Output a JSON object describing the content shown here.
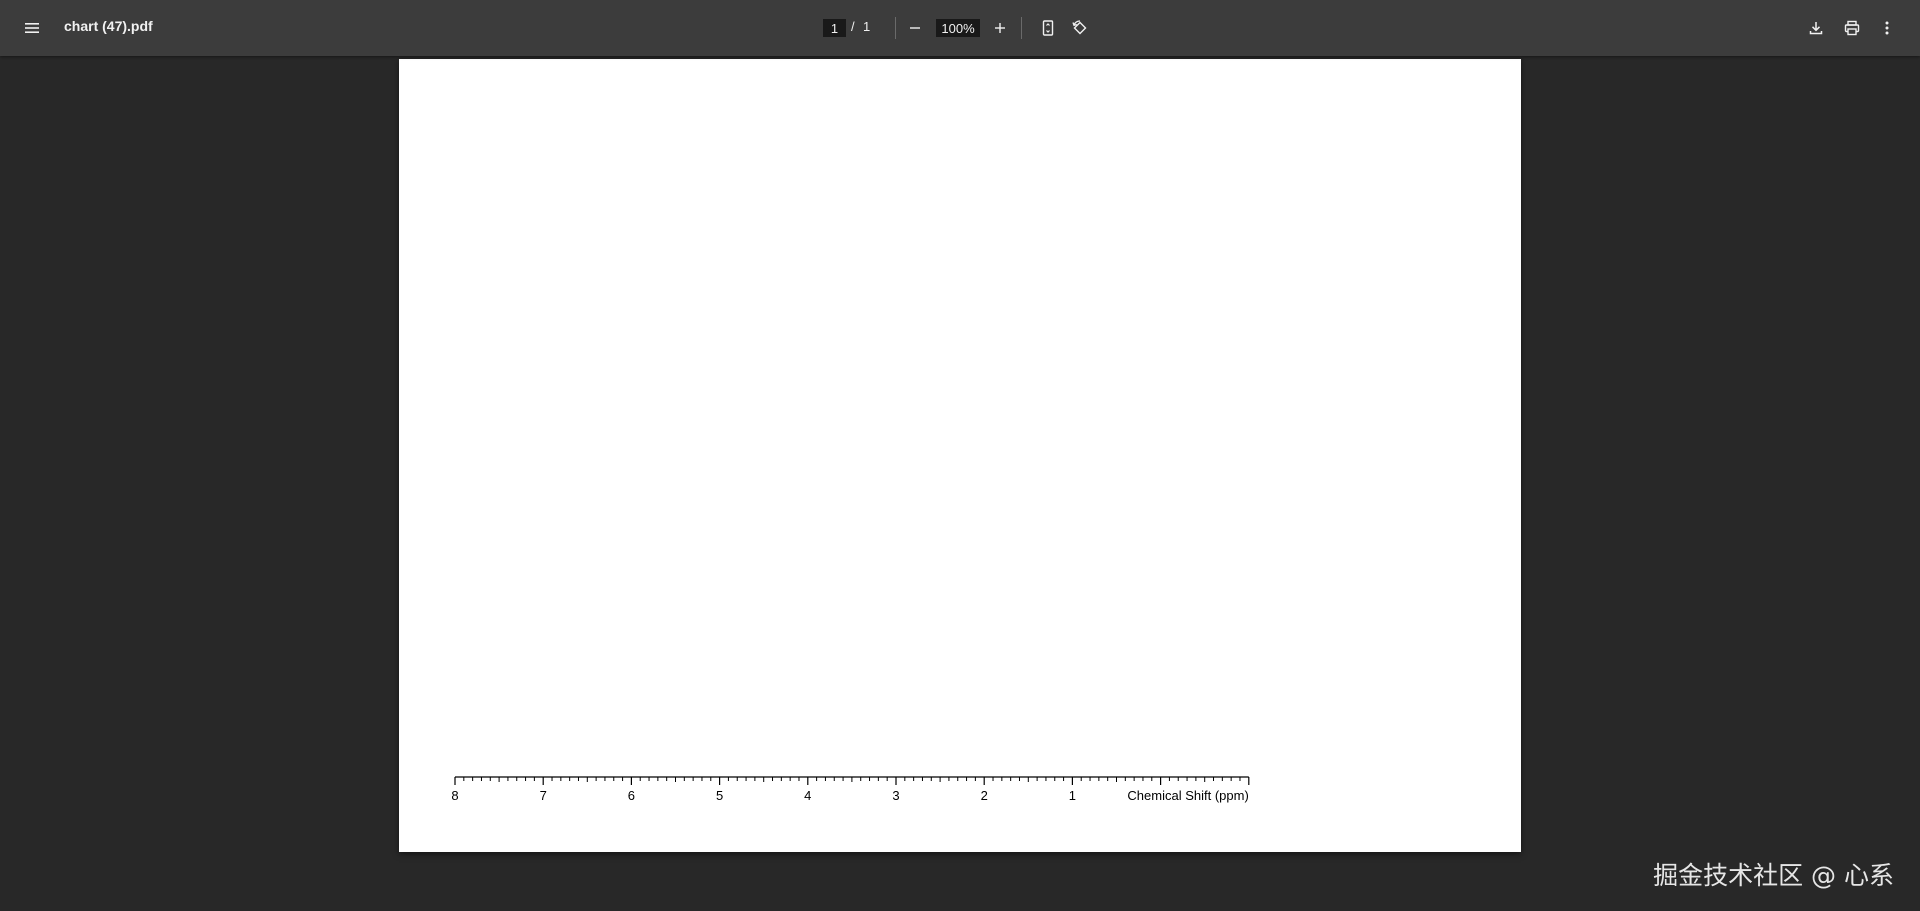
{
  "toolbar": {
    "menu_icon": "menu-icon",
    "title": "chart (47).pdf",
    "page_current": "1",
    "page_separator": "/",
    "page_total": "1",
    "zoom_value": "100%",
    "zoom_out_icon": "minus-icon",
    "zoom_in_icon": "plus-icon",
    "fit_page_icon": "fit-to-page-icon",
    "rotate_icon": "rotate-icon",
    "download_icon": "download-icon",
    "print_icon": "print-icon",
    "more_icon": "more-vert-icon"
  },
  "chart_data": {
    "type": "line",
    "x_ticks": [
      8,
      7,
      6,
      5,
      4,
      3,
      2,
      1
    ],
    "x_tick_labels": [
      "8",
      "7",
      "6",
      "5",
      "4",
      "3",
      "2",
      "1"
    ],
    "xlabel": "Chemical Shift (ppm)",
    "xlim": [
      8,
      -1
    ],
    "x_reversed": true,
    "minor_ticks_per_unit": 10,
    "series": [],
    "grid": false
  },
  "watermark": "掘金技术社区 @ 心系"
}
